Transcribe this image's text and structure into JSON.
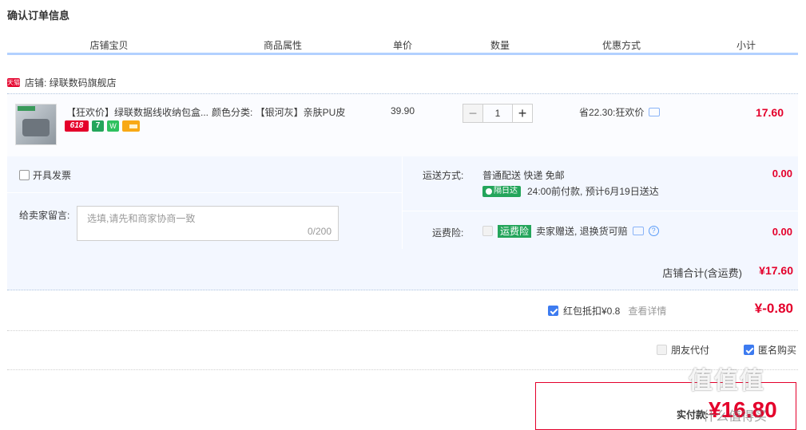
{
  "page": {
    "title": "确认订单信息"
  },
  "table_header": [
    "店铺宝贝",
    "商品属性",
    "单价",
    "数量",
    "优惠方式",
    "小计"
  ],
  "shop": {
    "badge": "天猫",
    "label": "店铺: 绿联数码旗舰店"
  },
  "item": {
    "name": "【狂欢价】绿联数据线收纳包盒...",
    "badges": [
      "618",
      "7",
      "W"
    ],
    "attribute": "颜色分类: 【银河灰】亲肤PU皮",
    "price": "39.90",
    "qty_minus": "−",
    "qty_value": "1",
    "qty_plus": "+",
    "promo": "省22.30:狂欢价",
    "subtotal": "17.60"
  },
  "invoice": {
    "label": "开具发票"
  },
  "message": {
    "label": "给卖家留言:",
    "placeholder": "选填,请先和商家协商一致",
    "count": "0/200"
  },
  "shipping": {
    "label": "运送方式:",
    "value": "普通配送 快递 免邮",
    "tag": "隔日达",
    "eta": "24:00前付款, 预计6月19日送达",
    "fee": "0.00"
  },
  "insurance": {
    "label": "运费险:",
    "tag": "运费险",
    "text": "卖家赠送, 退换货可赔",
    "help": "?",
    "fee": "0.00"
  },
  "shop_total": {
    "label": "店铺合计(含运费)",
    "value": "¥17.60"
  },
  "hongbao": {
    "label": "红包抵扣¥0.8",
    "link": "查看详情",
    "value": "¥-0.80"
  },
  "options": {
    "friend_pay": "朋友代付",
    "anonymous": "匿名购买"
  },
  "payment": {
    "label": "实付款:",
    "value": "¥16.80"
  },
  "watermark": {
    "text": "值值值",
    "sub": "什么值得买"
  },
  "colors": {
    "accent_red": "#e4002b",
    "header_line": "#b2d1ff",
    "panel_bg": "#f3f7ff",
    "green": "#24a55b"
  }
}
